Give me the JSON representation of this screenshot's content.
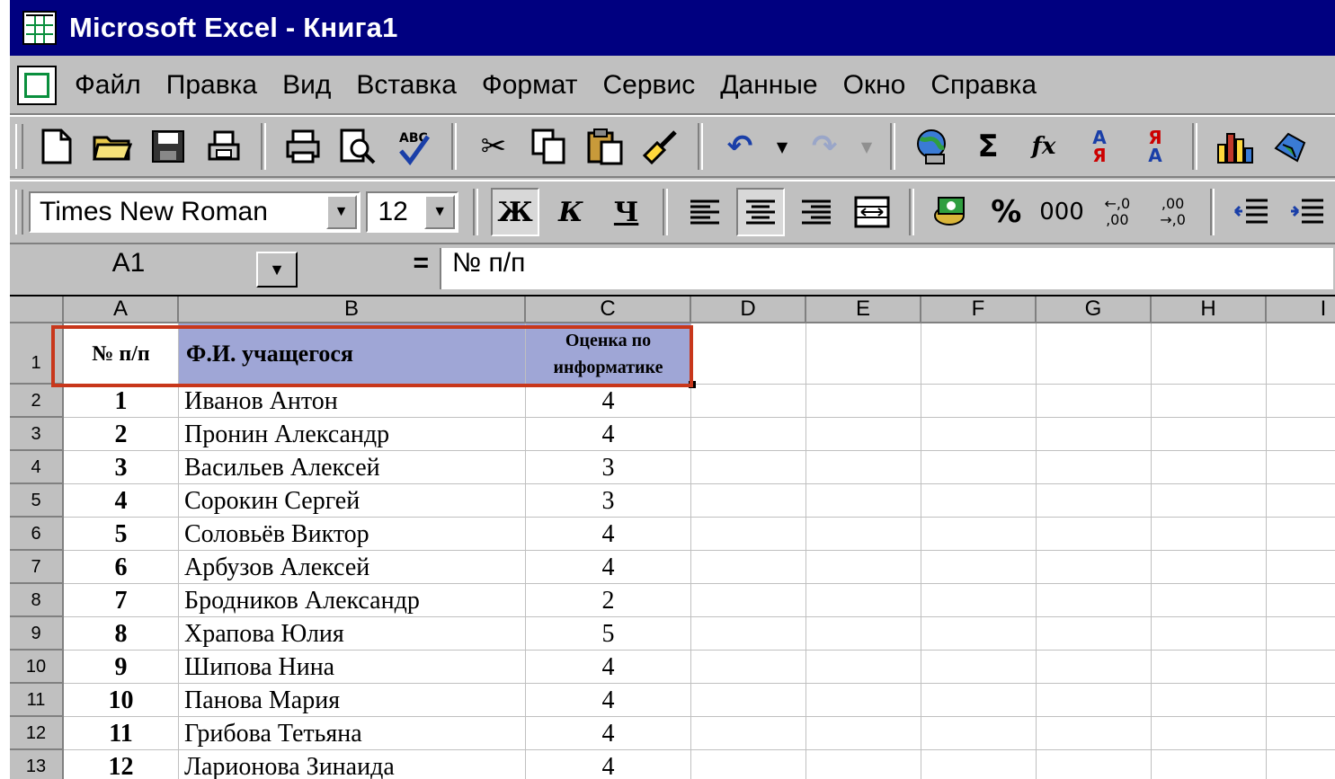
{
  "window": {
    "title": "Microsoft Excel - Книга1"
  },
  "menu": [
    {
      "label": "Файл"
    },
    {
      "label": "Правка"
    },
    {
      "label": "Вид"
    },
    {
      "label": "Вставка"
    },
    {
      "label": "Формат"
    },
    {
      "label": "Сервис"
    },
    {
      "label": "Данные"
    },
    {
      "label": "Окно"
    },
    {
      "label": "Справка"
    }
  ],
  "toolbar_standard": {
    "sum_symbol": "Σ",
    "fx_symbol": "fx"
  },
  "toolbar_format": {
    "font_name": "Times New Roman",
    "font_size": "12",
    "bold_label": "Ж",
    "italic_label": "К",
    "underline_label": "Ч",
    "percent_label": "%",
    "thousands_label": "000"
  },
  "formula_bar": {
    "name_box": "A1",
    "equals": "=",
    "content": "№ п/п"
  },
  "columns": [
    "A",
    "B",
    "C",
    "D",
    "E",
    "F",
    "G",
    "H",
    "I"
  ],
  "rows": [
    "1",
    "2",
    "3",
    "4",
    "5",
    "6",
    "7",
    "8",
    "9",
    "10",
    "11",
    "12",
    "13"
  ],
  "table": {
    "header": {
      "num": "№ п/п",
      "name": "Ф.И. учащегося",
      "grade": "Оценка по информатике"
    },
    "records": [
      {
        "num": "1",
        "name": "Иванов Антон",
        "grade": "4"
      },
      {
        "num": "2",
        "name": "Пронин Александр",
        "grade": "4"
      },
      {
        "num": "3",
        "name": "Васильев Алексей",
        "grade": "3"
      },
      {
        "num": "4",
        "name": "Сорокин  Сергей",
        "grade": "3"
      },
      {
        "num": "5",
        "name": "Соловьёв Виктор",
        "grade": "4"
      },
      {
        "num": "6",
        "name": "Арбузов Алексей",
        "grade": "4"
      },
      {
        "num": "7",
        "name": "Бродников Александр",
        "grade": "2"
      },
      {
        "num": "8",
        "name": "Храпова Юлия",
        "grade": "5"
      },
      {
        "num": "9",
        "name": "Шипова  Нина",
        "grade": "4"
      },
      {
        "num": "10",
        "name": "Панова  Мария",
        "grade": "4"
      },
      {
        "num": "11",
        "name": "Грибова Тетьяна",
        "grade": "4"
      },
      {
        "num": "12",
        "name": "Ларионова Зинаида",
        "grade": "4"
      }
    ]
  },
  "colors": {
    "title_bar": "#000080",
    "header_fill": "#9fa6d6",
    "highlight": "#c8371b",
    "chrome": "#c0c0c0"
  }
}
